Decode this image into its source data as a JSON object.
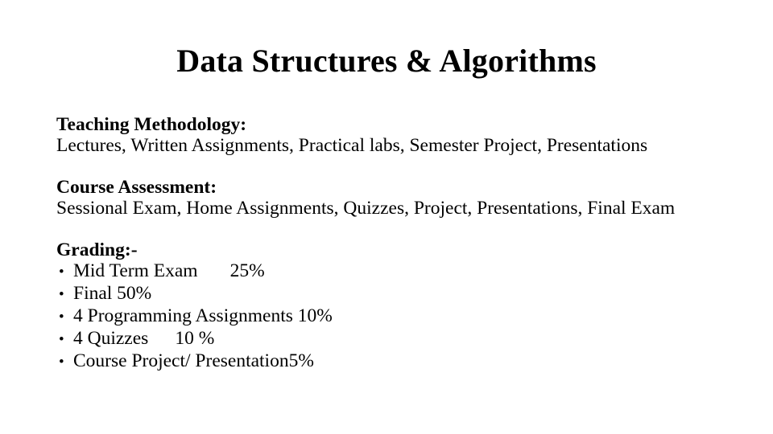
{
  "slide": {
    "title": "Data Structures & Algorithms",
    "background_color": "#ffffff",
    "text_color": "#000000",
    "sections": [
      {
        "heading": "Teaching Methodology:",
        "line": "Lectures, Written Assignments, Practical labs, Semester Project, Presentations"
      },
      {
        "heading": "Course Assessment:",
        "line": "Sessional Exam, Home Assignments, Quizzes, Project, Presentations, Final Exam"
      },
      {
        "heading": "Grading:-",
        "bullets": [
          {
            "marker": "bullet-dot",
            "label": "Mid Term Exam",
            "value": "25%",
            "gap": "tab"
          },
          {
            "marker": "bullet-dot",
            "label": "Final 50%",
            "value": "",
            "gap": "none"
          },
          {
            "marker": "bullet-dot",
            "label": "4 Programming Assignments 10%",
            "value": "",
            "gap": "none"
          },
          {
            "marker": "bullet-dot",
            "label": "4 Quizzes",
            "value": "10 %",
            "gap": "tab"
          },
          {
            "marker": "bullet-dot",
            "label": "Course Project/ Presentation5%",
            "value": "",
            "gap": "none"
          }
        ]
      }
    ]
  }
}
